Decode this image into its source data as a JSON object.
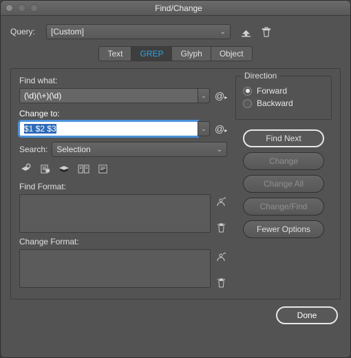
{
  "window": {
    "title": "Find/Change"
  },
  "query": {
    "label": "Query:",
    "value": "[Custom]"
  },
  "tabs": [
    "Text",
    "GREP",
    "Glyph",
    "Object"
  ],
  "active_tab": "GREP",
  "find_what": {
    "label": "Find what:",
    "value": "(\\d)(\\+)(\\d)"
  },
  "change_to": {
    "label": "Change to:",
    "value": "$1 $2 $3"
  },
  "search": {
    "label": "Search:",
    "value": "Selection"
  },
  "find_format": {
    "label": "Find Format:"
  },
  "change_format": {
    "label": "Change Format:"
  },
  "direction": {
    "label": "Direction",
    "options": [
      "Forward",
      "Backward"
    ],
    "selected": "Forward"
  },
  "buttons": {
    "find_next": "Find Next",
    "change": "Change",
    "change_all": "Change All",
    "change_find": "Change/Find",
    "fewer_options": "Fewer Options",
    "done": "Done"
  }
}
